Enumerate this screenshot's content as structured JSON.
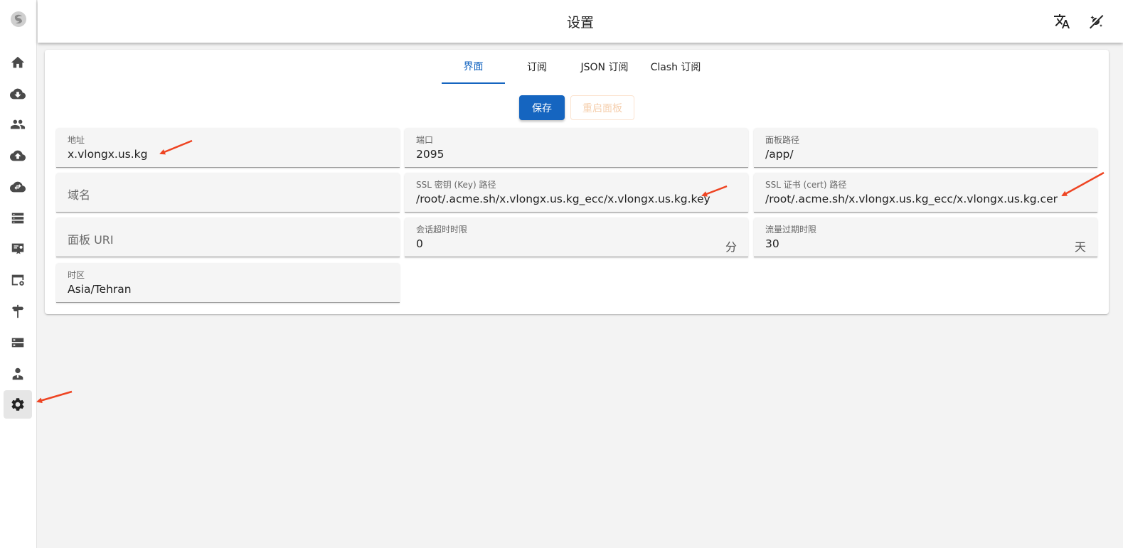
{
  "header": {
    "title": "设置",
    "icons": [
      "translate-icon",
      "theme-toggle-icon"
    ]
  },
  "sidebar": {
    "logo": "app-logo",
    "items": [
      {
        "name": "home",
        "icon": "home-icon"
      },
      {
        "name": "download",
        "icon": "cloud-download-icon"
      },
      {
        "name": "users",
        "icon": "users-icon"
      },
      {
        "name": "upload",
        "icon": "cloud-upload-icon"
      },
      {
        "name": "sync",
        "icon": "cloud-sync-icon"
      },
      {
        "name": "servers",
        "icon": "server-list-icon"
      },
      {
        "name": "certificates",
        "icon": "certificate-icon"
      },
      {
        "name": "card-settings",
        "icon": "card-settings-icon"
      },
      {
        "name": "routing",
        "icon": "signpost-icon"
      },
      {
        "name": "storage",
        "icon": "storage-icon"
      },
      {
        "name": "admin",
        "icon": "admin-user-icon"
      },
      {
        "name": "settings",
        "icon": "gear-icon",
        "active": true
      }
    ]
  },
  "tabs": [
    {
      "label": "界面",
      "active": true
    },
    {
      "label": "订阅"
    },
    {
      "label": "JSON 订阅"
    },
    {
      "label": "Clash 订阅"
    }
  ],
  "buttons": {
    "save": "保存",
    "restart": "重启面板"
  },
  "fields": {
    "address": {
      "label": "地址",
      "value": "x.vlongx.us.kg"
    },
    "port": {
      "label": "端口",
      "value": "2095"
    },
    "panel_path": {
      "label": "面板路径",
      "value": "/app/"
    },
    "domain": {
      "placeholder": "域名"
    },
    "ssl_key": {
      "label": "SSL 密钥 (Key) 路径",
      "value": "/root/.acme.sh/x.vlongx.us.kg_ecc/x.vlongx.us.kg.key"
    },
    "ssl_cert": {
      "label": "SSL 证书 (cert) 路径",
      "value": "/root/.acme.sh/x.vlongx.us.kg_ecc/x.vlongx.us.kg.cer"
    },
    "panel_uri": {
      "placeholder": "面板 URI"
    },
    "session_timeout": {
      "label": "会话超时时限",
      "value": "0",
      "suffix": "分"
    },
    "traffic_expire": {
      "label": "流量过期时限",
      "value": "30",
      "suffix": "天"
    },
    "timezone": {
      "label": "时区",
      "value": "Asia/Tehran"
    }
  },
  "colors": {
    "primary": "#1565c0",
    "annotation_arrow": "#ee4422",
    "restart_text": "#f5cfae"
  }
}
